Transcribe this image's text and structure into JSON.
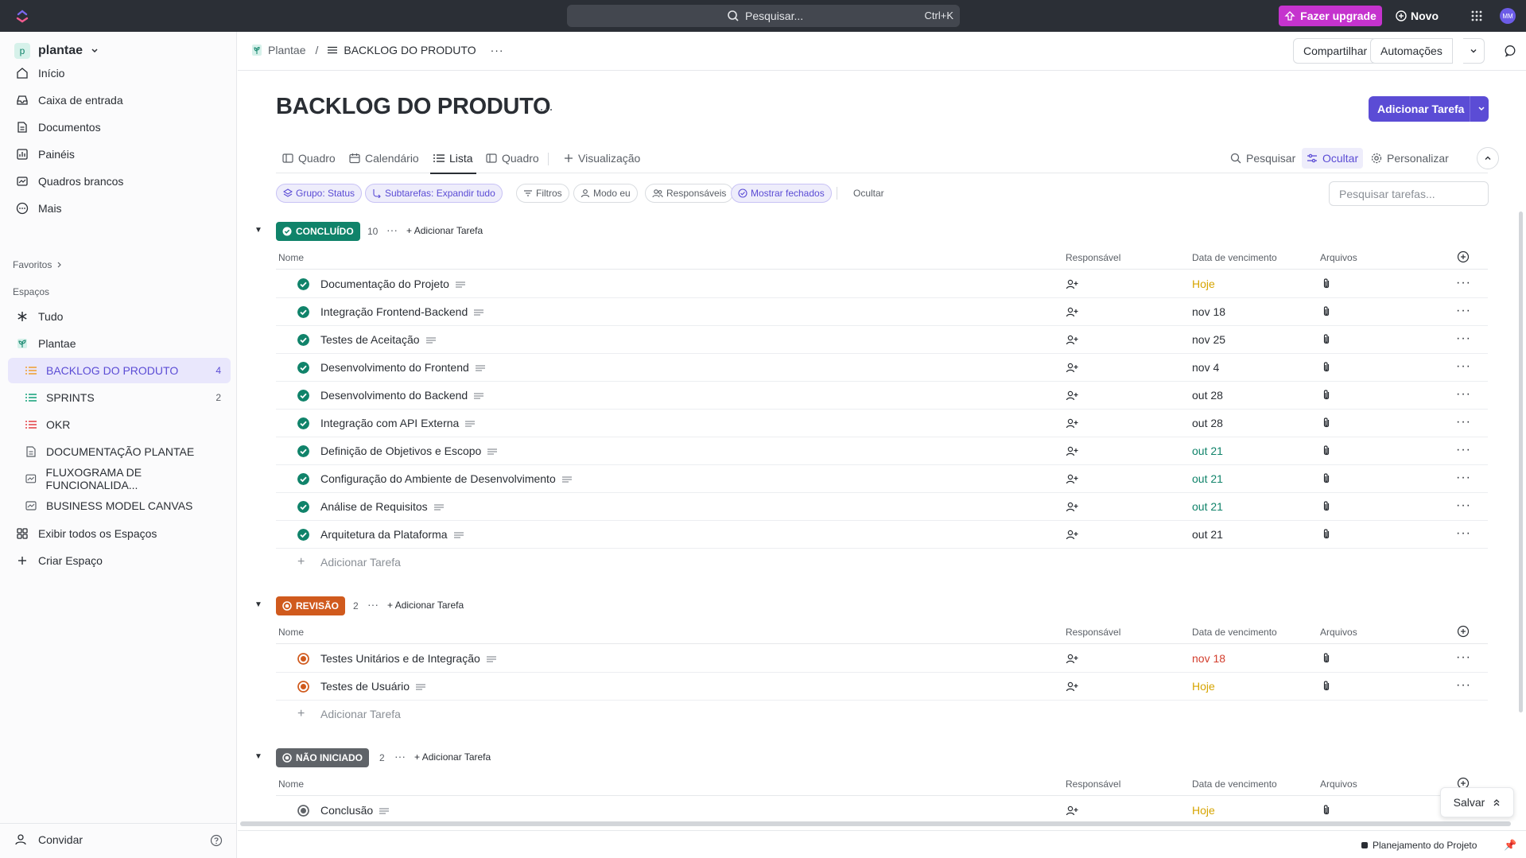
{
  "topbar": {
    "search_placeholder": "Pesquisar...",
    "search_shortcut": "Ctrl+K",
    "upgrade_label": "Fazer upgrade",
    "new_label": "Novo",
    "avatar_initials": "MM"
  },
  "sidebar": {
    "workspace_badge": "p",
    "workspace_name": "plantae",
    "nav": [
      {
        "label": "Início",
        "icon": "home-icon"
      },
      {
        "label": "Caixa de entrada",
        "icon": "inbox-icon"
      },
      {
        "label": "Documentos",
        "icon": "docs-icon"
      },
      {
        "label": "Painéis",
        "icon": "dashboard-icon"
      },
      {
        "label": "Quadros brancos",
        "icon": "whiteboard-icon"
      },
      {
        "label": "Mais",
        "icon": "more-circle-icon"
      }
    ],
    "favorites_label": "Favoritos",
    "spaces_label": "Espaços",
    "spaces": [
      {
        "label": "Tudo",
        "icon": "asterisk-icon"
      },
      {
        "label": "Plantae",
        "icon": "plant-icon"
      }
    ],
    "lists": [
      {
        "label": "BACKLOG DO PRODUTO",
        "count": "4",
        "icon": "list-icon",
        "color": "#f0a33a"
      },
      {
        "label": "SPRINTS",
        "count": "2",
        "icon": "list-icon",
        "color": "#1fa57f"
      },
      {
        "label": "OKR",
        "count": "",
        "icon": "list-icon",
        "color": "#e5484d"
      },
      {
        "label": "DOCUMENTAÇÃO PLANTAE",
        "count": "",
        "icon": "doc-icon",
        "color": "#5a5f66"
      },
      {
        "label": "FLUXOGRAMA DE FUNCIONALIDA...",
        "count": "",
        "icon": "whiteboard-icon",
        "color": "#5a5f66"
      },
      {
        "label": "BUSINESS MODEL CANVAS",
        "count": "",
        "icon": "whiteboard-icon",
        "color": "#5a5f66"
      }
    ],
    "show_all_spaces": "Exibir todos os Espaços",
    "create_space": "Criar Espaço",
    "invite": "Convidar"
  },
  "header": {
    "breadcrumb_space": "Plantae",
    "breadcrumb_sep": "/",
    "breadcrumb_current": "BACKLOG DO PRODUTO",
    "share": "Compartilhar",
    "automations": "Automações"
  },
  "main": {
    "title": "BACKLOG DO PRODUTO",
    "add_task": "Adicionar Tarefa",
    "tabs": [
      "Quadro",
      "Calendário",
      "Lista",
      "Quadro",
      "Visualização"
    ],
    "tools": [
      "Pesquisar",
      "Ocultar",
      "Personalizar"
    ],
    "chips": [
      "Grupo: Status",
      "Subtarefas: Expandir tudo",
      "Filtros",
      "Modo eu",
      "Responsáveis",
      "Mostrar fechados",
      "Ocultar"
    ],
    "task_search_placeholder": "Pesquisar tarefas...",
    "columns": {
      "name": "Nome",
      "assignee": "Responsável",
      "due": "Data de vencimento",
      "files": "Arquivos"
    },
    "add_task_inline": "Adicionar Tarefa",
    "add_task_row": "Adicionar Tarefa"
  },
  "groups": [
    {
      "status": "CONCLUÍDO",
      "count": "10",
      "color": "#10836a",
      "tasks": [
        {
          "name": "Documentação do Projeto",
          "due": "Hoje",
          "due_style": "today"
        },
        {
          "name": "Integração Frontend-Backend",
          "due": "nov 18",
          "due_style": ""
        },
        {
          "name": "Testes de Aceitação",
          "due": "nov 25",
          "due_style": ""
        },
        {
          "name": "Desenvolvimento do Frontend",
          "due": "nov 4",
          "due_style": ""
        },
        {
          "name": "Desenvolvimento do Backend",
          "due": "out 28",
          "due_style": ""
        },
        {
          "name": "Integração com API Externa",
          "due": "out 28",
          "due_style": ""
        },
        {
          "name": "Definição de Objetivos e Escopo",
          "due": "out 21",
          "due_style": "green"
        },
        {
          "name": "Configuração do Ambiente de Desenvolvimento",
          "due": "out 21",
          "due_style": "green"
        },
        {
          "name": "Análise de Requisitos",
          "due": "out 21",
          "due_style": "green"
        },
        {
          "name": "Arquitetura da Plataforma",
          "due": "out 21",
          "due_style": ""
        }
      ]
    },
    {
      "status": "REVISÃO",
      "count": "2",
      "color": "#d05a1d",
      "tasks": [
        {
          "name": "Testes Unitários e de Integração",
          "due": "nov 18",
          "due_style": "red"
        },
        {
          "name": "Testes de Usuário",
          "due": "Hoje",
          "due_style": "today"
        }
      ]
    },
    {
      "status": "NÃO INICIADO",
      "count": "2",
      "color": "#5f6368",
      "tasks": [
        {
          "name": "Conclusão",
          "due": "Hoje",
          "due_style": "today"
        }
      ]
    }
  ],
  "footer": {
    "save": "Salvar",
    "planning": "Planejamento do Projeto"
  }
}
